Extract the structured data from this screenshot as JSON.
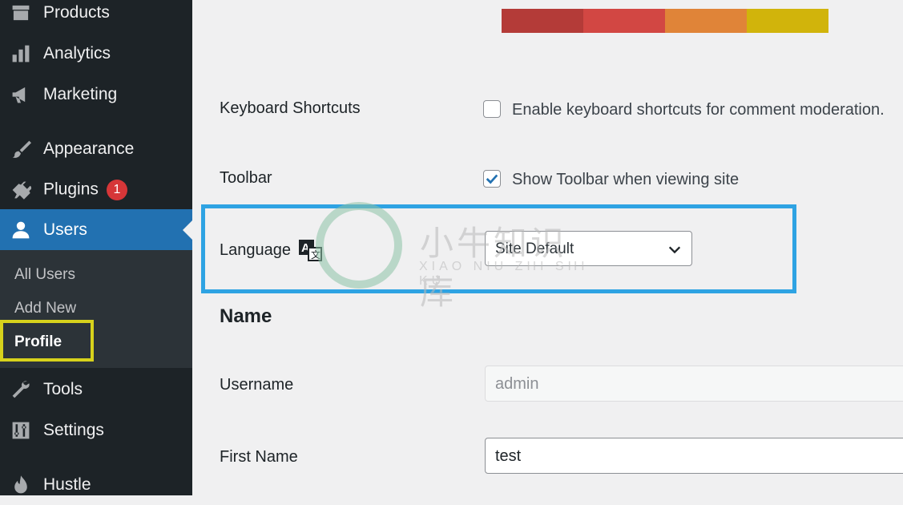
{
  "sidebar": {
    "items": [
      {
        "label": "Products",
        "icon": "archive-icon"
      },
      {
        "label": "Analytics",
        "icon": "bar-chart-icon"
      },
      {
        "label": "Marketing",
        "icon": "megaphone-icon"
      },
      {
        "label": "Appearance",
        "icon": "paintbrush-icon"
      },
      {
        "label": "Plugins",
        "icon": "plug-icon",
        "badge": "1"
      },
      {
        "label": "Users",
        "icon": "user-icon"
      },
      {
        "label": "Tools",
        "icon": "wrench-icon"
      },
      {
        "label": "Settings",
        "icon": "sliders-icon"
      },
      {
        "label": "Hustle",
        "icon": "hustle-icon"
      }
    ],
    "submenu": [
      "All Users",
      "Add New",
      "Profile"
    ]
  },
  "color_scheme": [
    "#b43b38",
    "#d24743",
    "#e08438",
    "#d1b40b"
  ],
  "form": {
    "keyboard_shortcuts": {
      "label": "Keyboard Shortcuts",
      "checkbox_text": "Enable keyboard shortcuts for comment moderation.",
      "checked": false
    },
    "toolbar": {
      "label": "Toolbar",
      "checkbox_text": "Show Toolbar when viewing site",
      "checked": true
    },
    "language": {
      "label": "Language",
      "selected": "Site Default"
    },
    "name_section": "Name",
    "username": {
      "label": "Username",
      "value": "admin"
    },
    "first_name": {
      "label": "First Name",
      "value": "test"
    }
  },
  "watermark": {
    "text_cn": "小牛知识库",
    "text_en": "XIAO NIU ZHI SHI KU"
  },
  "colors": {
    "sidebar_bg": "#1d2327",
    "active_bg": "#2271b1",
    "badge": "#d63638",
    "profile_highlight": "#d7d21c",
    "language_highlight": "#2ea3e3"
  }
}
